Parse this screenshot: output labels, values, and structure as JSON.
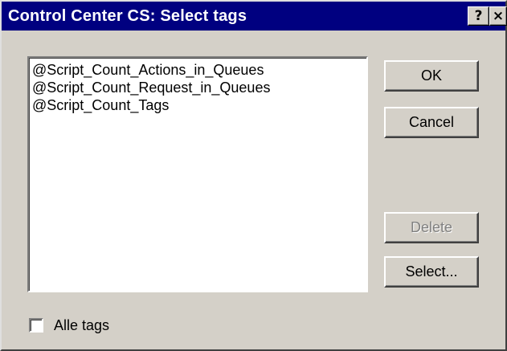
{
  "window": {
    "title": "Control Center CS: Select tags",
    "help_glyph": "?",
    "close_glyph": "×"
  },
  "tags_list": {
    "items": [
      "@Script_Count_Actions_in_Queues",
      "@Script_Count_Request_in_Queues",
      "@Script_Count_Tags"
    ]
  },
  "buttons": {
    "ok_label": "OK",
    "cancel_label": "Cancel",
    "delete_label": "Delete",
    "select_label": "Select..."
  },
  "checkbox": {
    "label": "Alle tags",
    "checked": false
  },
  "colors": {
    "titlebar": "#000080",
    "face": "#d4d0c8"
  }
}
